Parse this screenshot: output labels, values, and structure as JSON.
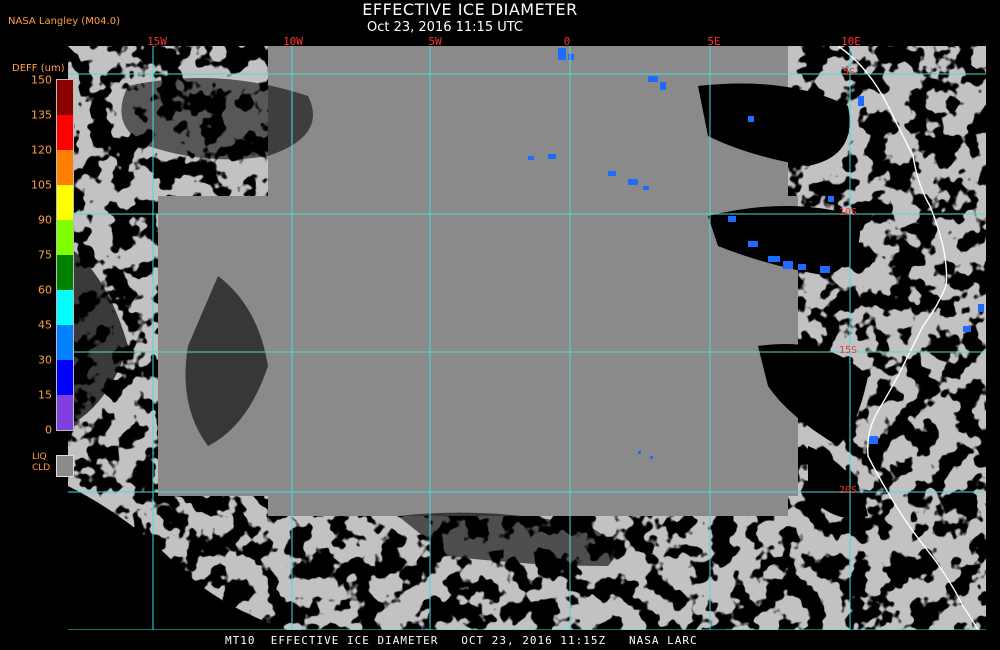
{
  "header": {
    "title": "EFFECTIVE ICE DIAMETER",
    "subtitle": "Oct 23, 2016 11:15 UTC",
    "agency": "NASA Langley (M04.0)"
  },
  "longitude_labels": [
    "15W",
    "10W",
    "5W",
    "0",
    "5E",
    "10E"
  ],
  "latitude_labels": [
    "5S",
    "10S",
    "15S",
    "20S"
  ],
  "legend": {
    "title": "DEFF (um)",
    "ticks": [
      "150",
      "135",
      "120",
      "105",
      "90",
      "75",
      "60",
      "45",
      "30",
      "15",
      "0"
    ],
    "colors_top_to_bottom": [
      "#8b0000",
      "#ff0000",
      "#ff8000",
      "#ffff00",
      "#80ff00",
      "#008000",
      "#00ffff",
      "#0080ff",
      "#0000ff",
      "#8040e0"
    ],
    "liquid_label_line1": "LIQ",
    "liquid_label_line2": "CLD",
    "liquid_color": "#8a8a8a"
  },
  "colors": {
    "grid": "#40e0e0",
    "coastline": "#ffffff",
    "background": "#000000",
    "ice_cloud": "#1e6cff"
  },
  "footer": {
    "text": "MT10  EFFECTIVE ICE DIAMETER   OCT 23, 2016 11:15Z   NASA LARC"
  }
}
